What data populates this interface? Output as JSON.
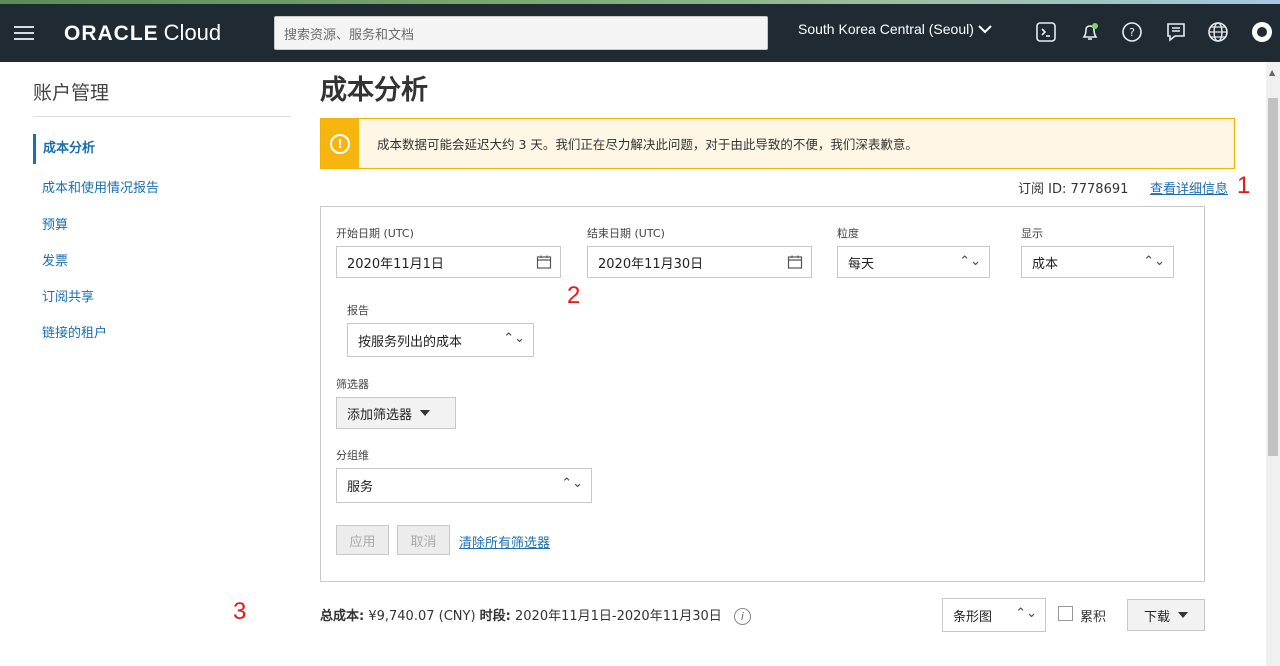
{
  "topbar": {
    "logo_brand": "ORACLE",
    "logo_product": "Cloud",
    "search_placeholder": "搜索资源、服务和文档",
    "region": "South Korea Central (Seoul)"
  },
  "sidebar": {
    "title": "账户管理",
    "items": [
      {
        "label": "成本分析",
        "active": true
      },
      {
        "label": "成本和使用情况报告"
      },
      {
        "label": "预算"
      },
      {
        "label": "发票"
      },
      {
        "label": "订阅共享"
      },
      {
        "label": "链接的租户"
      }
    ]
  },
  "main": {
    "title": "成本分析",
    "warning": "成本数据可能会延迟大约 3 天。我们正在尽力解决此问题，对于由此导致的不便，我们深表歉意。",
    "subscription_id": "订阅 ID: 7778691",
    "details_link": "查看详细信息"
  },
  "form": {
    "start_label": "开始日期 (UTC)",
    "start_value": "2020年11月1日",
    "end_label": "结束日期 (UTC)",
    "end_value": "2020年11月30日",
    "granularity_label": "粒度",
    "granularity_value": "每天",
    "display_label": "显示",
    "display_value": "成本",
    "report_label": "报告",
    "report_value": "按服务列出的成本",
    "filter_label": "筛选器",
    "add_filter": "添加筛选器",
    "group_label": "分组维",
    "group_value": "服务",
    "apply": "应用",
    "cancel": "取消",
    "clear_filters": "清除所有筛选器"
  },
  "summary": {
    "total_label": "总成本:",
    "total_value": "¥9,740.07 (CNY)",
    "period_label": "时段:",
    "period_value": "2020年11月1日-2020年11月30日",
    "chart_type": "条形图",
    "cumulative": "累积",
    "download": "下载"
  },
  "annotations": [
    "1",
    "2",
    "3"
  ],
  "colors": {
    "topbar": "#1f2a33",
    "warning_accent": "#f7b510",
    "link": "#1a6fb0",
    "annotation": "#e31a1a"
  }
}
